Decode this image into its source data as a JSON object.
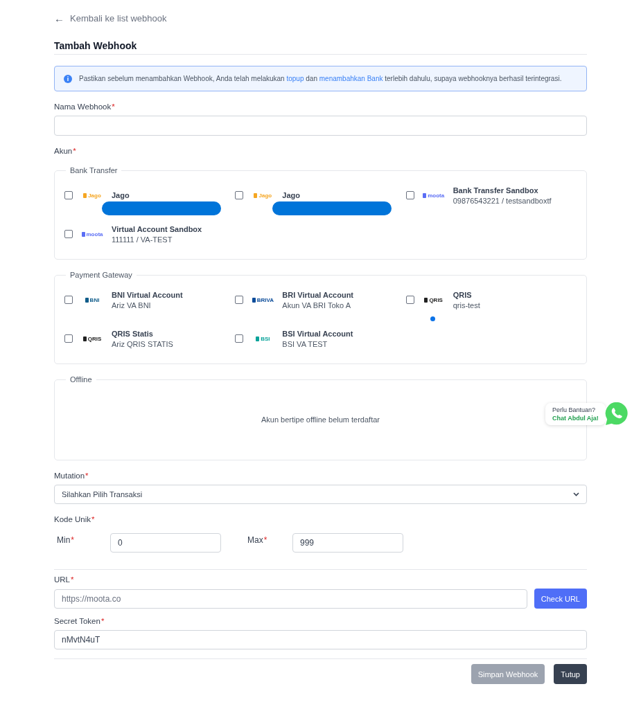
{
  "back_link": {
    "arrow": "←",
    "label": "Kembali ke list webhook"
  },
  "title": "Tambah Webhook",
  "alert": {
    "icon": "i",
    "parts": [
      {
        "text": "Pastikan sebelum menambahkan Webhook, Anda telah melakukan ",
        "link": false
      },
      {
        "text": "topup",
        "link": true
      },
      {
        "text": " dan ",
        "link": false
      },
      {
        "text": "menambahkan Bank",
        "link": true
      },
      {
        "text": " terlebih dahulu, supaya webhooknya berhasil terintegrasi.",
        "link": false
      }
    ]
  },
  "name_field": {
    "label": "Nama Webhook",
    "required": "*"
  },
  "account_label": {
    "label": "Akun",
    "required": "*"
  },
  "groups": [
    {
      "legend": "Bank Transfer",
      "items": [
        {
          "logo": "Jago",
          "color": "#f5a623",
          "name": "Jago",
          "redacted": true,
          "checked": false,
          "dot": false
        },
        {
          "logo": "Jago",
          "color": "#f5a623",
          "name": "Jago",
          "redacted": true,
          "checked": false,
          "dot": false
        },
        {
          "logo": "moota",
          "color": "#5b6ef5",
          "name": "Bank Transfer Sandbox",
          "detail": "09876543221 / testsandboxtf",
          "redacted": false,
          "checked": false,
          "dot": false
        },
        {
          "logo": "moota",
          "color": "#5b6ef5",
          "name": "Virtual Account Sandbox",
          "detail": "111111 / VA-TEST",
          "redacted": false,
          "checked": false,
          "dot": false
        }
      ]
    },
    {
      "legend": "Payment Gateway",
      "items": [
        {
          "logo": "BNI",
          "color": "#0f5c8a",
          "name": "BNI Virtual Account",
          "detail": "Ariz VA BNI",
          "redacted": false,
          "checked": false,
          "dot": false
        },
        {
          "logo": "BRIVA",
          "color": "#0b4c9a",
          "name": "BRI Virtual Account",
          "detail": "Akun VA BRI Toko A",
          "redacted": false,
          "checked": false,
          "dot": false
        },
        {
          "logo": "QRIS",
          "color": "#222222",
          "name": "QRIS",
          "detail": "qris-test",
          "redacted": false,
          "checked": false,
          "dot": true
        },
        {
          "logo": "QRIS",
          "color": "#222222",
          "name": "QRIS Statis",
          "detail": "Ariz QRIS STATIS",
          "redacted": false,
          "checked": false,
          "dot": false
        },
        {
          "logo": "BSI",
          "color": "#0aa39a",
          "name": "BSI Virtual Account",
          "detail": "BSI VA TEST",
          "redacted": false,
          "checked": false,
          "dot": false
        }
      ]
    },
    {
      "legend": "Offline",
      "empty_message": "Akun bertipe offline belum terdaftar"
    }
  ],
  "mutation": {
    "label": "Mutation",
    "required": "*",
    "value": "Silahkan Pilih Transaksi"
  },
  "unique_code": {
    "label": "Kode Unik",
    "required": "*",
    "min_label": "Min",
    "min_required": "*",
    "min_value": "0",
    "max_label": "Max",
    "max_required": "*",
    "max_value": "999"
  },
  "url": {
    "label": "URL",
    "required": "*",
    "placeholder": "https://moota.co",
    "button": "Check URL"
  },
  "secret": {
    "label": "Secret Token",
    "required": "*",
    "value": "nMvtN4uT"
  },
  "actions": [
    {
      "label": "Simpan Webhook",
      "kind": "secondary",
      "disabled": true
    },
    {
      "label": "Tutup",
      "kind": "dark",
      "disabled": false
    }
  ],
  "chat": {
    "line1": "Perlu Bantuan?",
    "line2": "Chat Abdul Aja!"
  }
}
